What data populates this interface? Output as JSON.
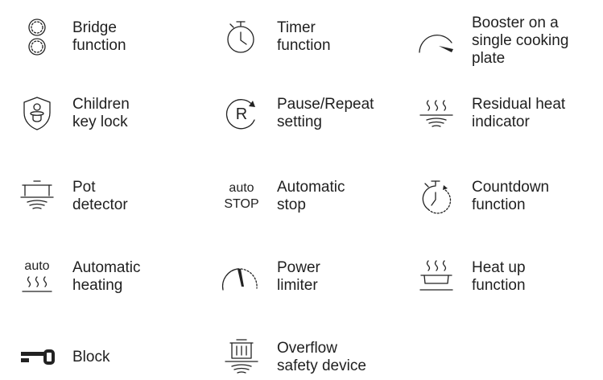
{
  "items": [
    {
      "label": "Bridge\nfunction",
      "icon": "bridge-icon"
    },
    {
      "label": "Timer\nfunction",
      "icon": "stopwatch-icon"
    },
    {
      "label": "Booster on a\nsingle cooking\nplate",
      "icon": "booster-gauge-icon"
    },
    {
      "label": "Children\nkey lock",
      "icon": "child-lock-icon"
    },
    {
      "label": "Pause/Repeat\nsetting",
      "icon": "pause-repeat-icon"
    },
    {
      "label": "Residual heat\nindicator",
      "icon": "residual-heat-icon"
    },
    {
      "label": "Pot\ndetector",
      "icon": "pot-detector-icon"
    },
    {
      "label": "Automatic\nstop",
      "icon": "auto-stop-icon",
      "icon_text": "auto\nSTOP"
    },
    {
      "label": "Countdown\nfunction",
      "icon": "countdown-icon"
    },
    {
      "label": "Automatic\nheating",
      "icon": "automatic-heating-icon",
      "icon_text": "auto"
    },
    {
      "label": "Power\nlimiter",
      "icon": "power-limiter-icon"
    },
    {
      "label": "Heat up\nfunction",
      "icon": "heat-up-icon"
    },
    {
      "label": "Block",
      "icon": "block-icon"
    },
    {
      "label": "Overflow\nsafety device",
      "icon": "overflow-safety-icon"
    }
  ]
}
